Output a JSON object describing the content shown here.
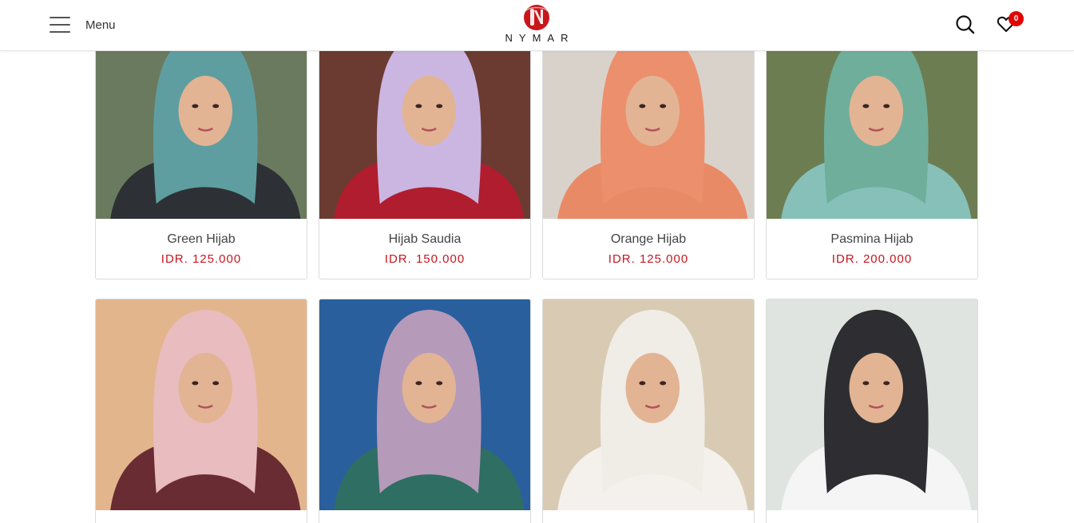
{
  "header": {
    "menu_label": "Menu",
    "brand": "NYMAR",
    "logo_letter": "N",
    "wishlist_count": "0",
    "icons": {
      "menu": "hamburger-icon",
      "search": "search-icon",
      "wishlist": "heart-icon"
    },
    "colors": {
      "brand": "#c8161d",
      "badge": "#e00000"
    }
  },
  "products": [
    {
      "name": "Green Hijab",
      "price": "IDR. 125.000",
      "hijab_color": "#5f9ea0",
      "bg_color": "#6a7a5e",
      "outfit_color": "#2d3135"
    },
    {
      "name": "Hijab Saudia",
      "price": "IDR. 150.000",
      "hijab_color": "#cbb6e2",
      "bg_color": "#6b3b32",
      "outfit_color": "#b01d2e"
    },
    {
      "name": "Orange Hijab",
      "price": "IDR. 125.000",
      "hijab_color": "#ec8f6c",
      "bg_color": "#d9d2cb",
      "outfit_color": "#e98a66"
    },
    {
      "name": "Pasmina Hijab",
      "price": "IDR. 200.000",
      "hijab_color": "#6fae9b",
      "bg_color": "#6d7d52",
      "outfit_color": "#86c0b8"
    },
    {
      "name": "",
      "price": "",
      "hijab_color": "#e9bcbf",
      "bg_color": "#e3b58d",
      "outfit_color": "#6a2c33"
    },
    {
      "name": "",
      "price": "",
      "hijab_color": "#b59aba",
      "bg_color": "#2a5f9e",
      "outfit_color": "#2f6e62"
    },
    {
      "name": "",
      "price": "",
      "hijab_color": "#f0ece6",
      "bg_color": "#d9cbb3",
      "outfit_color": "#f4f1ec"
    },
    {
      "name": "",
      "price": "",
      "hijab_color": "#2e2e32",
      "bg_color": "#dfe4e0",
      "outfit_color": "#f5f5f5"
    }
  ]
}
